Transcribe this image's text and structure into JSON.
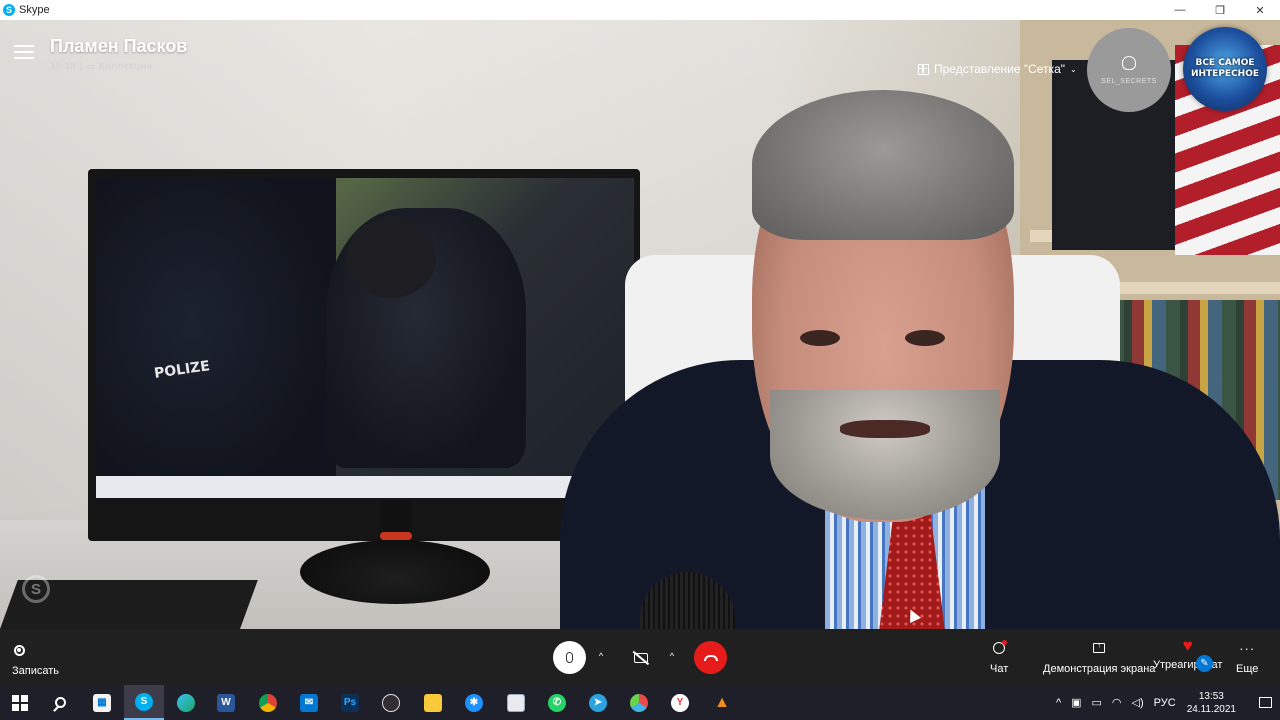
{
  "window": {
    "title": "Skype",
    "logo_letter": "S",
    "minimize": "—",
    "restore": "❐",
    "close": "✕"
  },
  "call": {
    "contact_name": "Пламен Пасков",
    "duration": "19:18",
    "separator": "|",
    "collection_label": "Коллекция",
    "grid_view_label": "Представление \"Сетка\"",
    "self_tile_label": "SEL_SECRETS",
    "channel_logo_text": "ВСЕ САМОЕ ИНТЕРЕСНОЕ",
    "video_police_text": "POLIZE",
    "watermark_letter": "S"
  },
  "controls": {
    "record_label": "Записать",
    "chat_label": "Чат",
    "share_label": "Демонстрация экрана",
    "react_label": "Утреагироват",
    "more_label": "Еще",
    "more_glyph": "···",
    "chevron_glyph": "^",
    "heart_glyph": "♥",
    "edit_glyph": "✎"
  },
  "taskbar": {
    "apps": [
      "start",
      "search",
      "store",
      "skype",
      "edge",
      "word",
      "chrome",
      "mail",
      "photoshop",
      "obs",
      "explorer",
      "network",
      "paint",
      "whatsapp",
      "telegram",
      "davinci",
      "yandex",
      "vlc"
    ],
    "tray_chevron": "^",
    "language": "РУС",
    "time": "13:53",
    "date": "24.11.2021"
  },
  "colors": {
    "hangup_red": "#e81b1b",
    "controls_bg": "#202020",
    "taskbar_bg": "#1f1f2a",
    "skype_blue": "#00aff0"
  }
}
